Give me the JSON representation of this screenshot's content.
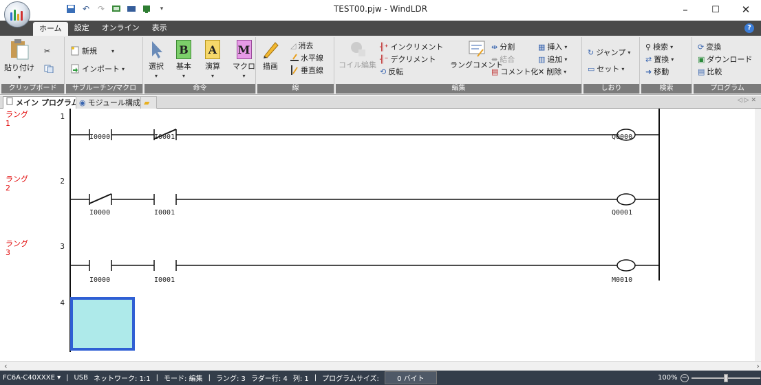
{
  "window": {
    "title": "TEST00.pjw - WindLDR",
    "minimize": "–",
    "maximize": "☐",
    "close": "✕"
  },
  "ribbon_tabs": [
    "ホーム",
    "設定",
    "オンライン",
    "表示"
  ],
  "active_tab": "ホーム",
  "help_label": "?",
  "groups": {
    "clipboard": {
      "label": "クリップボード",
      "paste": "貼り付け"
    },
    "subroutine": {
      "label": "サブルーチン/マクロ",
      "new": "新規",
      "import": "インポート"
    },
    "instruction": {
      "label": "命令",
      "select": "選択",
      "basic": "基本",
      "calc": "演算",
      "macro": "マクロ",
      "basic_letter": "B",
      "calc_letter": "A",
      "macro_letter": "M"
    },
    "line": {
      "label": "線",
      "draw": "描画",
      "erase": "消去",
      "hline": "水平線",
      "vline": "垂直線"
    },
    "edit": {
      "label": "編集",
      "coil_edit": "コイル編集",
      "increment": "インクリメント",
      "decrement": "デクリメント",
      "invert": "反転",
      "rung_comment": "ラングコメント",
      "split": "分割",
      "join": "結合",
      "comment_out": "コメント化",
      "insert": "挿入",
      "add": "追加",
      "delete": "削除"
    },
    "bookmark": {
      "label": "しおり",
      "jump": "ジャンプ",
      "set": "セット"
    },
    "search": {
      "label": "検索",
      "find": "検索",
      "replace": "置換",
      "move": "移動"
    },
    "program": {
      "label": "プログラム",
      "convert": "変換",
      "download": "ダウンロード",
      "compare": "比較"
    }
  },
  "doc_tabs": [
    "メイン プログラム",
    "モジュール構成"
  ],
  "rungs": [
    {
      "label": "ラング",
      "index": "1",
      "number": "1",
      "contacts": [
        {
          "addr": "I0000",
          "type": "NO"
        },
        {
          "addr": "I0001",
          "type": "NC"
        }
      ],
      "coil": "Q0000"
    },
    {
      "label": "ラング",
      "index": "2",
      "number": "2",
      "contacts": [
        {
          "addr": "I0000",
          "type": "NC"
        },
        {
          "addr": "I0001",
          "type": "NO"
        }
      ],
      "coil": "Q0001"
    },
    {
      "label": "ラング",
      "index": "3",
      "number": "3",
      "contacts": [
        {
          "addr": "I0000",
          "type": "NO"
        },
        {
          "addr": "I0001",
          "type": "NO"
        }
      ],
      "coil": "M0010"
    }
  ],
  "empty_rung_number": "4",
  "status": {
    "plc_type": "FC6A-C40XXXE",
    "connection": "USB",
    "network": "ネットワーク: 1:1",
    "mode": "モード: 編集",
    "rung": "ラング: 3",
    "ladder_row": "ラダー行: 4",
    "column": "列: 1",
    "program_size_label": "プログラムサイズ:",
    "program_size_value": "0 バイト",
    "zoom": "100%"
  },
  "colors": {
    "rung_label": "#e00000",
    "cursor_fill": "#aeeaea",
    "cursor_border": "#2f5fd4",
    "statusbar": "#333d4a",
    "tabbar": "#4a4a4a"
  }
}
